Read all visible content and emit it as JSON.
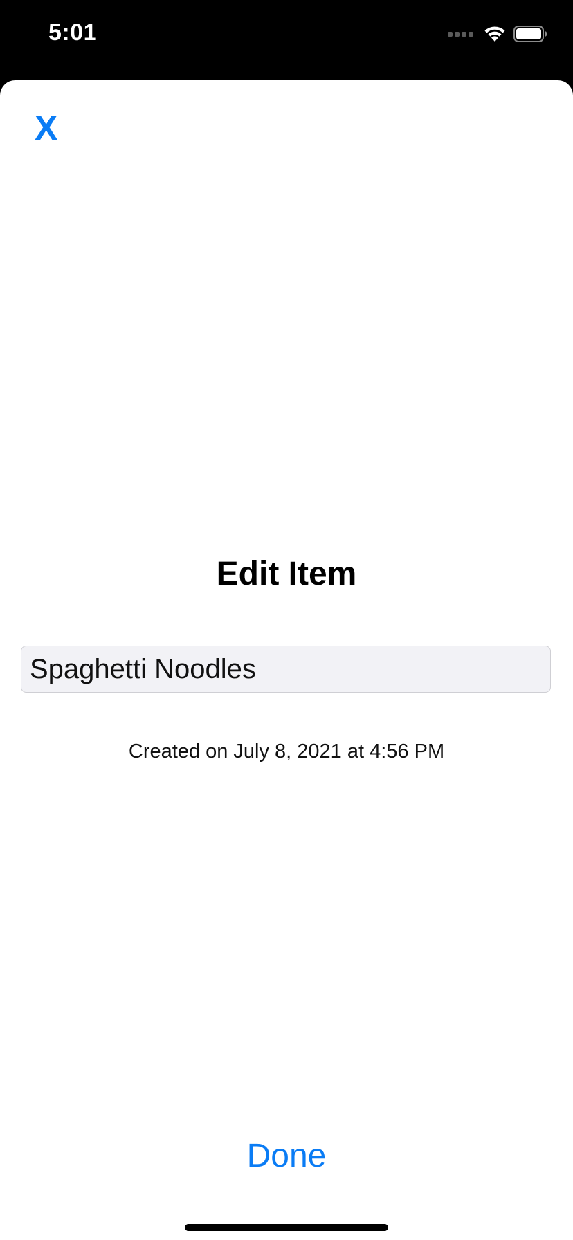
{
  "status_bar": {
    "time": "5:01",
    "icons": [
      "cellular-signal-icon",
      "wifi-icon",
      "battery-icon"
    ]
  },
  "sheet": {
    "close_label": "X",
    "title": "Edit Item",
    "name_field": {
      "value": "Spaghetti Noodles"
    },
    "created_text": "Created on July 8, 2021 at 4:56 PM",
    "done_label": "Done"
  },
  "colors": {
    "accent": "#0a7cf5",
    "status_bar_bg": "#000000",
    "sheet_bg": "#ffffff",
    "field_bg": "#f2f2f6"
  }
}
